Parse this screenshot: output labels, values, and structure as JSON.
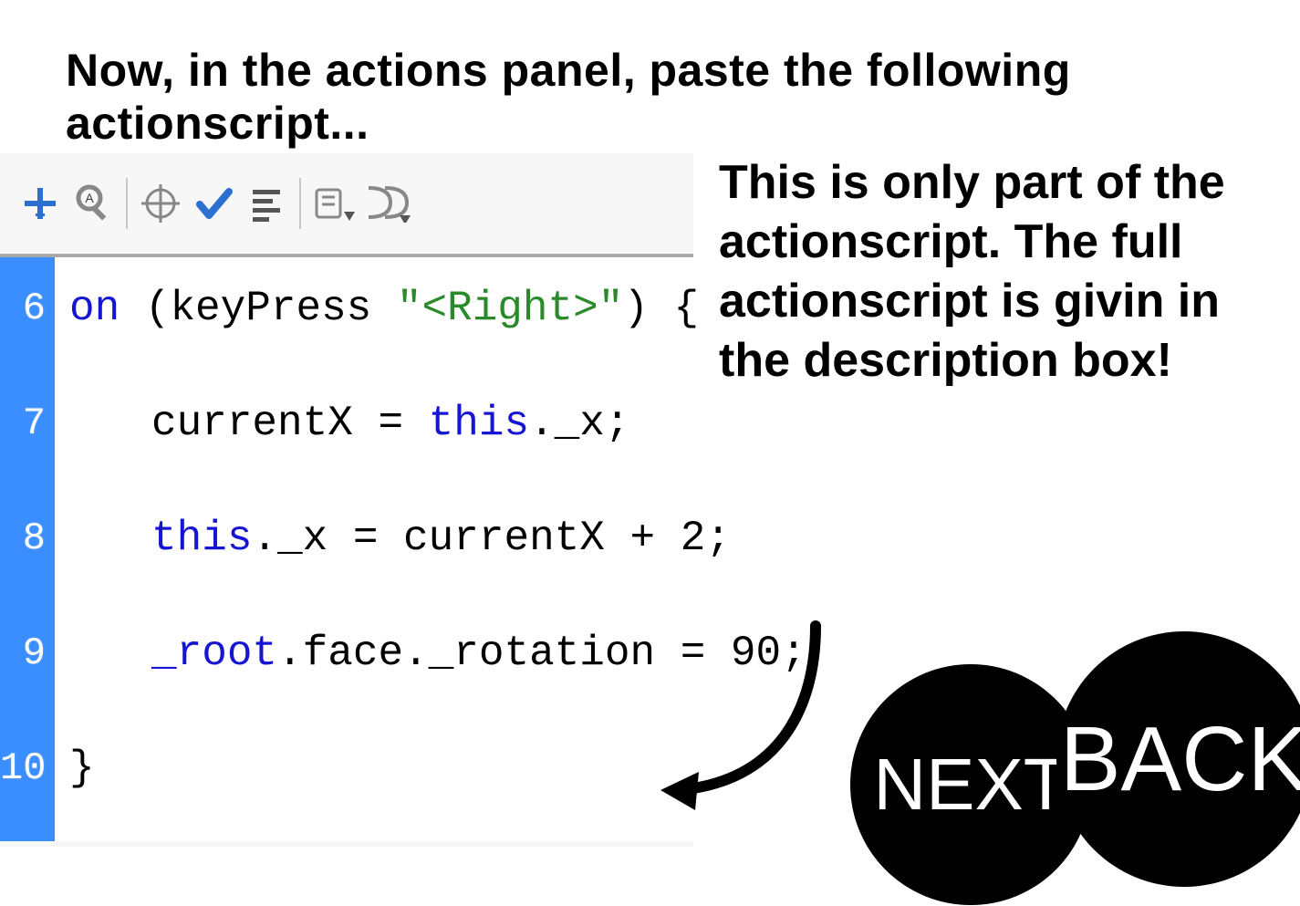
{
  "heading": "Now, in the actions panel, paste the following actionscript...",
  "toolbar": {
    "icons": [
      "add-snippet-icon",
      "find-icon",
      "target-icon",
      "check-syntax-icon",
      "auto-format-icon",
      "debug-options-icon",
      "code-collapse-icon"
    ]
  },
  "code": {
    "line_numbers": [
      "6",
      "7",
      "8",
      "9",
      "10"
    ],
    "l1_on": "on",
    "l1_paren_open": " (",
    "l1_kw": "keyPress",
    "l1_sp": " ",
    "l1_str": "\"<Right>\"",
    "l1_tail": ") {",
    "l2_a": "currentX = ",
    "l2_b": "this",
    "l2_c": "._x;",
    "l3_a": "this",
    "l3_b": "._x = currentX + ",
    "l3_c": "2",
    "l3_d": ";",
    "l4_a": "_root",
    "l4_b": ".face._rotation = ",
    "l4_c": "90",
    "l4_d": ";",
    "l5": "}"
  },
  "side_text": "This is only part of the actionscript. The full actionscript is givin in the description box!",
  "nav": {
    "next": "NEXT",
    "back": "BACK"
  }
}
